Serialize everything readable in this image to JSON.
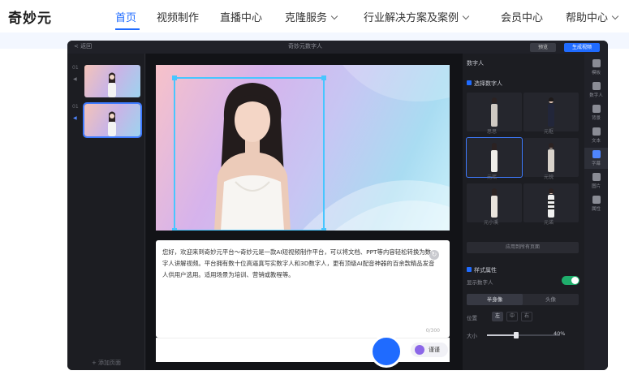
{
  "site": {
    "logo": "奇妙元",
    "nav": [
      {
        "label": "首页",
        "active": true,
        "dropdown": false
      },
      {
        "label": "视频制作",
        "dropdown": false
      },
      {
        "label": "直播中心",
        "dropdown": false
      },
      {
        "label": "克隆服务",
        "dropdown": true
      },
      {
        "label": "行业解决方案及案例",
        "dropdown": true
      },
      {
        "label": "会员中心",
        "dropdown": false
      },
      {
        "label": "帮助中心",
        "dropdown": true
      }
    ],
    "accent": "#1f6bff"
  },
  "editor": {
    "back_label": "< 返回",
    "title": "奇妙元数字人",
    "preview_btn": "预览",
    "export_btn": "生成视频",
    "scenes": [
      {
        "num": "01",
        "selected": false
      },
      {
        "num": "01",
        "selected": true
      }
    ],
    "add_page": "+ 添加页面",
    "script": {
      "text": "您好，欢迎来到奇妙元平台～奇妙元是一款AI短视频制作平台，可以将文档、PPT等内容轻松转换为数字人讲解视频。平台拥有数十位高逼真写实数字人和3D数字人，更有顶级AI配音神器的百余款精品发音人供用户选用。适用场景为培训、营销或教程等。",
      "count": "0/300",
      "voice": "谨谨"
    },
    "right_panel": {
      "title": "数字人",
      "select_check": "选择数字人",
      "avatars": [
        {
          "name": "思思"
        },
        {
          "name": "元枢"
        },
        {
          "name": "元瑶"
        },
        {
          "name": "元锐"
        },
        {
          "name": "元小溪"
        },
        {
          "name": "元诺"
        }
      ],
      "apply_all": "应用到所有页面",
      "style_check": "样式属性",
      "show_avatar": "显示数字人",
      "seg_on": "半身像",
      "seg_off": "头像",
      "position_label": "位置",
      "positions": [
        "左",
        "中",
        "右"
      ],
      "size_label": "大小",
      "size_value": "40%",
      "size_fraction": 0.4
    },
    "rail": [
      {
        "label": "模板",
        "icon": "template-icon"
      },
      {
        "label": "数字人",
        "icon": "avatar-icon"
      },
      {
        "label": "背景",
        "icon": "background-icon"
      },
      {
        "label": "文本",
        "icon": "text-icon"
      },
      {
        "label": "字幕",
        "icon": "subtitle-icon",
        "active": true
      },
      {
        "label": "图片",
        "icon": "image-icon"
      },
      {
        "label": "属性",
        "icon": "property-icon"
      }
    ]
  }
}
